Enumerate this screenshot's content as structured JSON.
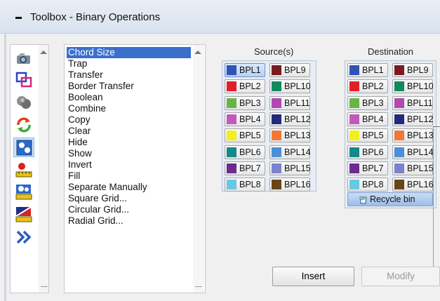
{
  "window": {
    "title": "Toolbox - Binary Operations"
  },
  "icons": [
    {
      "name": "camera-icon"
    },
    {
      "name": "overlap-squares-icon"
    },
    {
      "name": "merge-circles-icon"
    },
    {
      "name": "refresh-arrows-icon",
      "colors": [
        "#e0421c",
        "#3cad3a"
      ]
    },
    {
      "name": "binary-shapes-icon",
      "selected": true
    },
    {
      "name": "measure-point-icon"
    },
    {
      "name": "measure-circles-icon"
    },
    {
      "name": "measure-diagonal-icon"
    },
    {
      "name": "double-chevron-right-icon"
    }
  ],
  "operations": {
    "selected": "Chord Size",
    "items": [
      "Chord Size",
      "Trap",
      "Transfer",
      "Border Transfer",
      "Boolean",
      "Combine",
      "Copy",
      "Clear",
      "Hide",
      "Show",
      "Invert",
      "Fill",
      "Separate Manually",
      "Square Grid...",
      "Circular Grid...",
      "Radial Grid..."
    ]
  },
  "source": {
    "title": "Source(s)",
    "selected": "BPL1",
    "bitplanes": [
      {
        "label": "BPL1",
        "color": "#2f54b5"
      },
      {
        "label": "BPL2",
        "color": "#e02028"
      },
      {
        "label": "BPL3",
        "color": "#68b545"
      },
      {
        "label": "BPL4",
        "color": "#c457be"
      },
      {
        "label": "BPL5",
        "color": "#f3ef1b"
      },
      {
        "label": "BPL6",
        "color": "#14888a"
      },
      {
        "label": "BPL7",
        "color": "#6d2a90"
      },
      {
        "label": "BPL8",
        "color": "#66c9e5"
      },
      {
        "label": "BPL9",
        "color": "#7a1a22"
      },
      {
        "label": "BPL10",
        "color": "#12895b"
      },
      {
        "label": "BPL11",
        "color": "#b348b2"
      },
      {
        "label": "BPL12",
        "color": "#232a7c"
      },
      {
        "label": "BPL13",
        "color": "#f07a35"
      },
      {
        "label": "BPL14",
        "color": "#4c8fd6"
      },
      {
        "label": "BPL15",
        "color": "#7b83cc"
      },
      {
        "label": "BPL16",
        "color": "#6a4519"
      }
    ]
  },
  "destination": {
    "title": "Destination",
    "bitplanes": [
      {
        "label": "BPL1",
        "color": "#2f54b5"
      },
      {
        "label": "BPL2",
        "color": "#e02028"
      },
      {
        "label": "BPL3",
        "color": "#68b545"
      },
      {
        "label": "BPL4",
        "color": "#c457be"
      },
      {
        "label": "BPL5",
        "color": "#f3ef1b"
      },
      {
        "label": "BPL6",
        "color": "#14888a"
      },
      {
        "label": "BPL7",
        "color": "#6d2a90"
      },
      {
        "label": "BPL8",
        "color": "#66c9e5"
      },
      {
        "label": "BPL9",
        "color": "#7a1a22"
      },
      {
        "label": "BPL10",
        "color": "#12895b"
      },
      {
        "label": "BPL11",
        "color": "#b348b2"
      },
      {
        "label": "BPL12",
        "color": "#232a7c"
      },
      {
        "label": "BPL13",
        "color": "#f07a35"
      },
      {
        "label": "BPL14",
        "color": "#4c8fd6"
      },
      {
        "label": "BPL15",
        "color": "#7b83cc"
      },
      {
        "label": "BPL16",
        "color": "#6a4519"
      }
    ],
    "recycle_label": "Recycle bin"
  },
  "actions": {
    "insert_label": "Insert",
    "modify_label": "Modify"
  }
}
